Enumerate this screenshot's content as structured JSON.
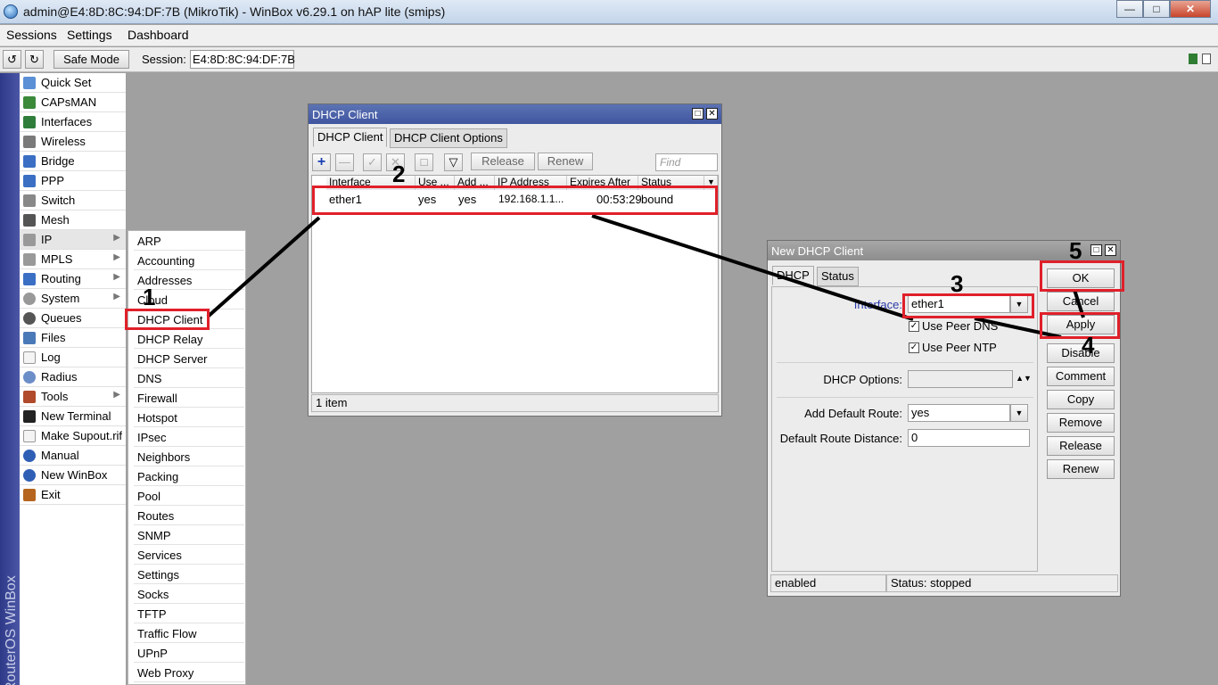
{
  "window": {
    "title": "admin@E4:8D:8C:94:DF:7B (MikroTik) - WinBox v6.29.1 on hAP lite (smips)",
    "controls": [
      "minimize",
      "maximize",
      "close"
    ]
  },
  "menubar": {
    "items": [
      "Sessions",
      "Settings",
      "Dashboard"
    ]
  },
  "toolbar": {
    "undo_icon": "undo-icon",
    "redo_icon": "redo-icon",
    "safe_mode": "Safe Mode",
    "session_label": "Session:",
    "session_value": "E4:8D:8C:94:DF:7B",
    "status_colors": [
      "#2e7d32",
      "#1b5e20"
    ]
  },
  "sidebar_brand": "RouterOS WinBox",
  "main_menu": {
    "items": [
      {
        "label": "Quick Set",
        "icon": "quick-set-icon",
        "has_sub": false
      },
      {
        "label": "CAPsMAN",
        "icon": "capsman-icon",
        "has_sub": false
      },
      {
        "label": "Interfaces",
        "icon": "interfaces-icon",
        "has_sub": false
      },
      {
        "label": "Wireless",
        "icon": "wireless-icon",
        "has_sub": false
      },
      {
        "label": "Bridge",
        "icon": "bridge-icon",
        "has_sub": false
      },
      {
        "label": "PPP",
        "icon": "ppp-icon",
        "has_sub": false
      },
      {
        "label": "Switch",
        "icon": "switch-icon",
        "has_sub": false
      },
      {
        "label": "Mesh",
        "icon": "mesh-icon",
        "has_sub": false
      },
      {
        "label": "IP",
        "icon": "ip-icon",
        "has_sub": true
      },
      {
        "label": "MPLS",
        "icon": "mpls-icon",
        "has_sub": true
      },
      {
        "label": "Routing",
        "icon": "routing-icon",
        "has_sub": true
      },
      {
        "label": "System",
        "icon": "system-icon",
        "has_sub": true
      },
      {
        "label": "Queues",
        "icon": "queues-icon",
        "has_sub": false
      },
      {
        "label": "Files",
        "icon": "files-icon",
        "has_sub": false
      },
      {
        "label": "Log",
        "icon": "log-icon",
        "has_sub": false
      },
      {
        "label": "Radius",
        "icon": "radius-icon",
        "has_sub": false
      },
      {
        "label": "Tools",
        "icon": "tools-icon",
        "has_sub": true
      },
      {
        "label": "New Terminal",
        "icon": "terminal-icon",
        "has_sub": false
      },
      {
        "label": "Make Supout.rif",
        "icon": "supout-icon",
        "has_sub": false
      },
      {
        "label": "Manual",
        "icon": "manual-icon",
        "has_sub": false
      },
      {
        "label": "New WinBox",
        "icon": "winbox-icon",
        "has_sub": false
      },
      {
        "label": "Exit",
        "icon": "exit-icon",
        "has_sub": false
      }
    ]
  },
  "ip_submenu": {
    "items": [
      "ARP",
      "Accounting",
      "Addresses",
      "Cloud",
      "DHCP Client",
      "DHCP Relay",
      "DHCP Server",
      "DNS",
      "Firewall",
      "Hotspot",
      "IPsec",
      "Neighbors",
      "Packing",
      "Pool",
      "Routes",
      "SNMP",
      "Services",
      "Settings",
      "Socks",
      "TFTP",
      "Traffic Flow",
      "UPnP",
      "Web Proxy"
    ]
  },
  "dhcp_client_window": {
    "title": "DHCP Client",
    "tabs": [
      "DHCP Client",
      "DHCP Client Options"
    ],
    "buttons": {
      "release": "Release",
      "renew": "Renew"
    },
    "find_placeholder": "Find",
    "columns": [
      "Interface",
      "Use ...",
      "Add ...",
      "IP Address",
      "Expires After",
      "Status"
    ],
    "rows": [
      {
        "interface": "ether1",
        "use": "yes",
        "add": "yes",
        "ip": "192.168.1.1...",
        "expires": "00:53:29",
        "status": "bound"
      }
    ],
    "status": "1 item"
  },
  "new_dhcp_window": {
    "title": "New DHCP Client",
    "tabs": [
      "DHCP",
      "Status"
    ],
    "interface_label": "Interface:",
    "interface_value": "ether1",
    "use_peer_dns": "Use Peer DNS",
    "use_peer_ntp": "Use Peer NTP",
    "dhcp_options_label": "DHCP Options:",
    "dhcp_options_value": "",
    "add_default_route_label": "Add Default Route:",
    "add_default_route_value": "yes",
    "route_distance_label": "Default Route Distance:",
    "route_distance_value": "0",
    "side_buttons": [
      "OK",
      "Cancel",
      "Apply",
      "Disable",
      "Comment",
      "Copy",
      "Remove",
      "Release",
      "Renew"
    ],
    "status_left": "enabled",
    "status_right": "Status: stopped"
  },
  "annotations": {
    "steps": [
      "1",
      "2",
      "3",
      "4",
      "5"
    ],
    "highlight_color": "#e0202a"
  }
}
